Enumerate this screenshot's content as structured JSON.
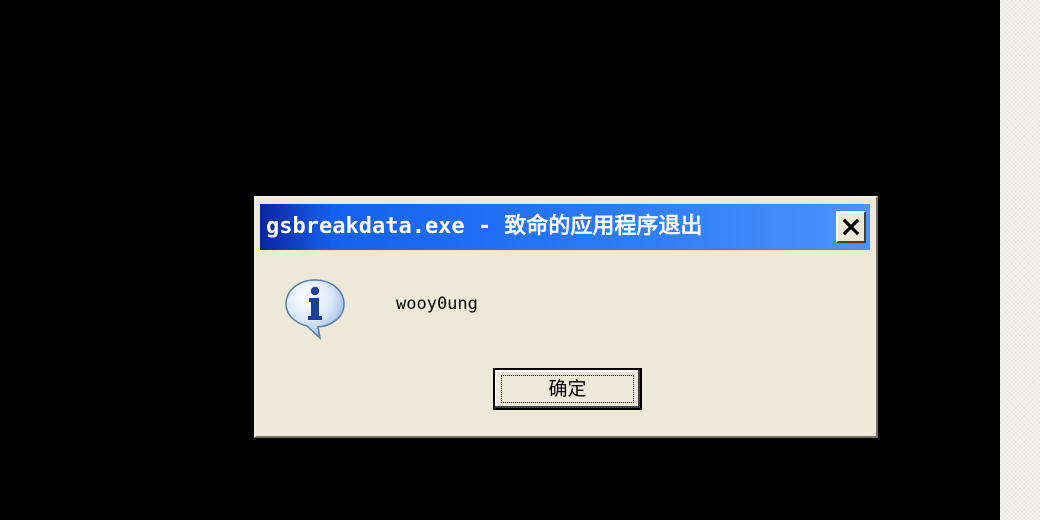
{
  "dialog": {
    "title": "gsbreakdata.exe - 致命的应用程序退出",
    "message": "wooy0ung",
    "ok_label": "确定",
    "close_icon": "close-icon",
    "info_icon": "info-icon"
  },
  "colors": {
    "titlebar": "#2d7cf8",
    "dialog_bg": "#ece9d8",
    "desktop_bg": "#000000"
  }
}
